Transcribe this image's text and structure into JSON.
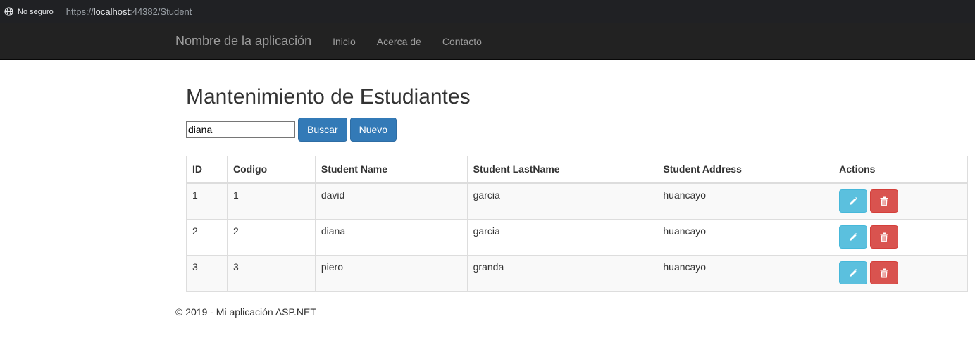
{
  "browser": {
    "security_label": "No seguro",
    "url_prefix": "https://",
    "url_host": "localhost",
    "url_rest": ":44382/Student"
  },
  "navbar": {
    "brand": "Nombre de la aplicación",
    "links": [
      "Inicio",
      "Acerca de",
      "Contacto"
    ]
  },
  "page": {
    "title": "Mantenimiento de Estudiantes"
  },
  "search": {
    "value": "diana",
    "buscar_label": "Buscar",
    "nuevo_label": "Nuevo"
  },
  "table": {
    "headers": [
      "ID",
      "Codigo",
      "Student Name",
      "Student LastName",
      "Student Address",
      "Actions"
    ],
    "rows": [
      {
        "id": "1",
        "codigo": "1",
        "name": "david",
        "lastname": "garcia",
        "address": "huancayo"
      },
      {
        "id": "2",
        "codigo": "2",
        "name": "diana",
        "lastname": "garcia",
        "address": "huancayo"
      },
      {
        "id": "3",
        "codigo": "3",
        "name": "piero",
        "lastname": "granda",
        "address": "huancayo"
      }
    ],
    "actions": {
      "edit_icon": "pencil-icon",
      "delete_icon": "trash-icon"
    }
  },
  "footer": {
    "text": "© 2019 - Mi aplicación ASP.NET"
  },
  "colors": {
    "navbar_bg": "#222222",
    "primary": "#337ab7",
    "info": "#5bc0de",
    "danger": "#d9534f"
  }
}
